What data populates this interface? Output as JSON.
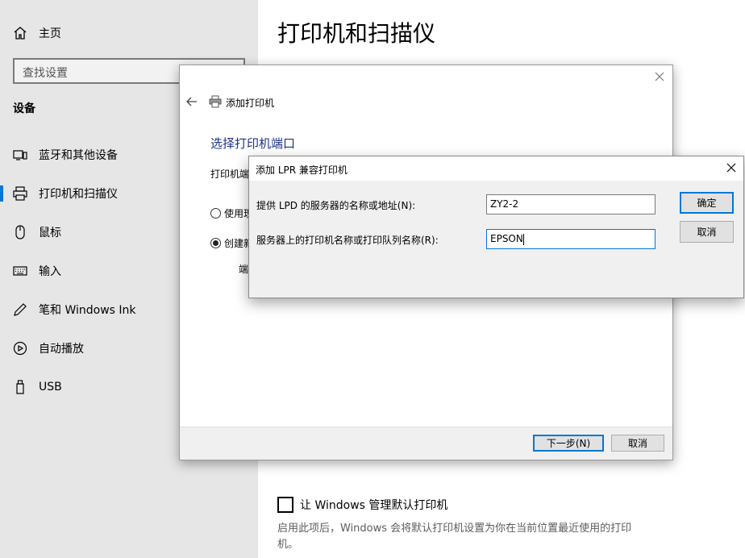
{
  "sidebar": {
    "home": "主页",
    "search_placeholder": "查找设置",
    "section_title": "设备",
    "items": [
      {
        "label": "蓝牙和其他设备",
        "icon": "bluetooth-devices-icon"
      },
      {
        "label": "打印机和扫描仪",
        "icon": "printer-icon",
        "active": true
      },
      {
        "label": "鼠标",
        "icon": "mouse-icon"
      },
      {
        "label": "输入",
        "icon": "keyboard-icon"
      },
      {
        "label": "笔和 Windows Ink",
        "icon": "pen-icon"
      },
      {
        "label": "自动播放",
        "icon": "autoplay-icon"
      },
      {
        "label": "USB",
        "icon": "usb-icon"
      }
    ]
  },
  "main": {
    "title": "打印机和扫描仪",
    "checkbox_label": "让 Windows 管理默认打印机",
    "checkbox_desc": "启用此项后，Windows 会将默认打印机设置为你在当前位置最近使用的打印机。"
  },
  "wizard": {
    "title": "添加打印机",
    "heading": "选择打印机端口",
    "desc": "打印机端",
    "radio_existing": "使用现",
    "radio_create": "创建新",
    "port_label": "端",
    "next_button": "下一步(N)",
    "cancel_button": "取消"
  },
  "lpr": {
    "title": "添加 LPR 兼容打印机",
    "server_label": "提供 LPD 的服务器的名称或地址(N):",
    "server_value": "ZY2-2",
    "queue_label": "服务器上的打印机名称或打印队列名称(R):",
    "queue_value": "EPSON",
    "ok_button": "确定",
    "cancel_button": "取消"
  },
  "colors": {
    "accent": "#0078d7",
    "heading_blue": "#1e3287",
    "sidebar_bg": "#e6e6e6"
  }
}
